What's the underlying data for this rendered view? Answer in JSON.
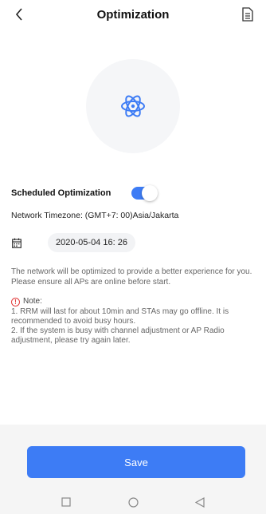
{
  "header": {
    "title": "Optimization"
  },
  "schedule": {
    "label": "Scheduled Optimization",
    "enabled": true
  },
  "timezone": {
    "text": "Network Timezone: (GMT+7: 00)Asia/Jakarta"
  },
  "date": {
    "value": "2020-05-04 16: 26"
  },
  "description": "The network will be optimized to provide a better experience for you. Please ensure all APs are online before start.",
  "note": {
    "title": "Note:",
    "items": [
      "1. RRM will last for about 10min and STAs may go offline. It is recommended to avoid busy hours.",
      "2. If the system is busy with channel adjustment or AP Radio adjustment, please try again later."
    ]
  },
  "footer": {
    "save_label": "Save"
  },
  "colors": {
    "accent": "#3d7cf5",
    "warning": "#e23c3c"
  }
}
